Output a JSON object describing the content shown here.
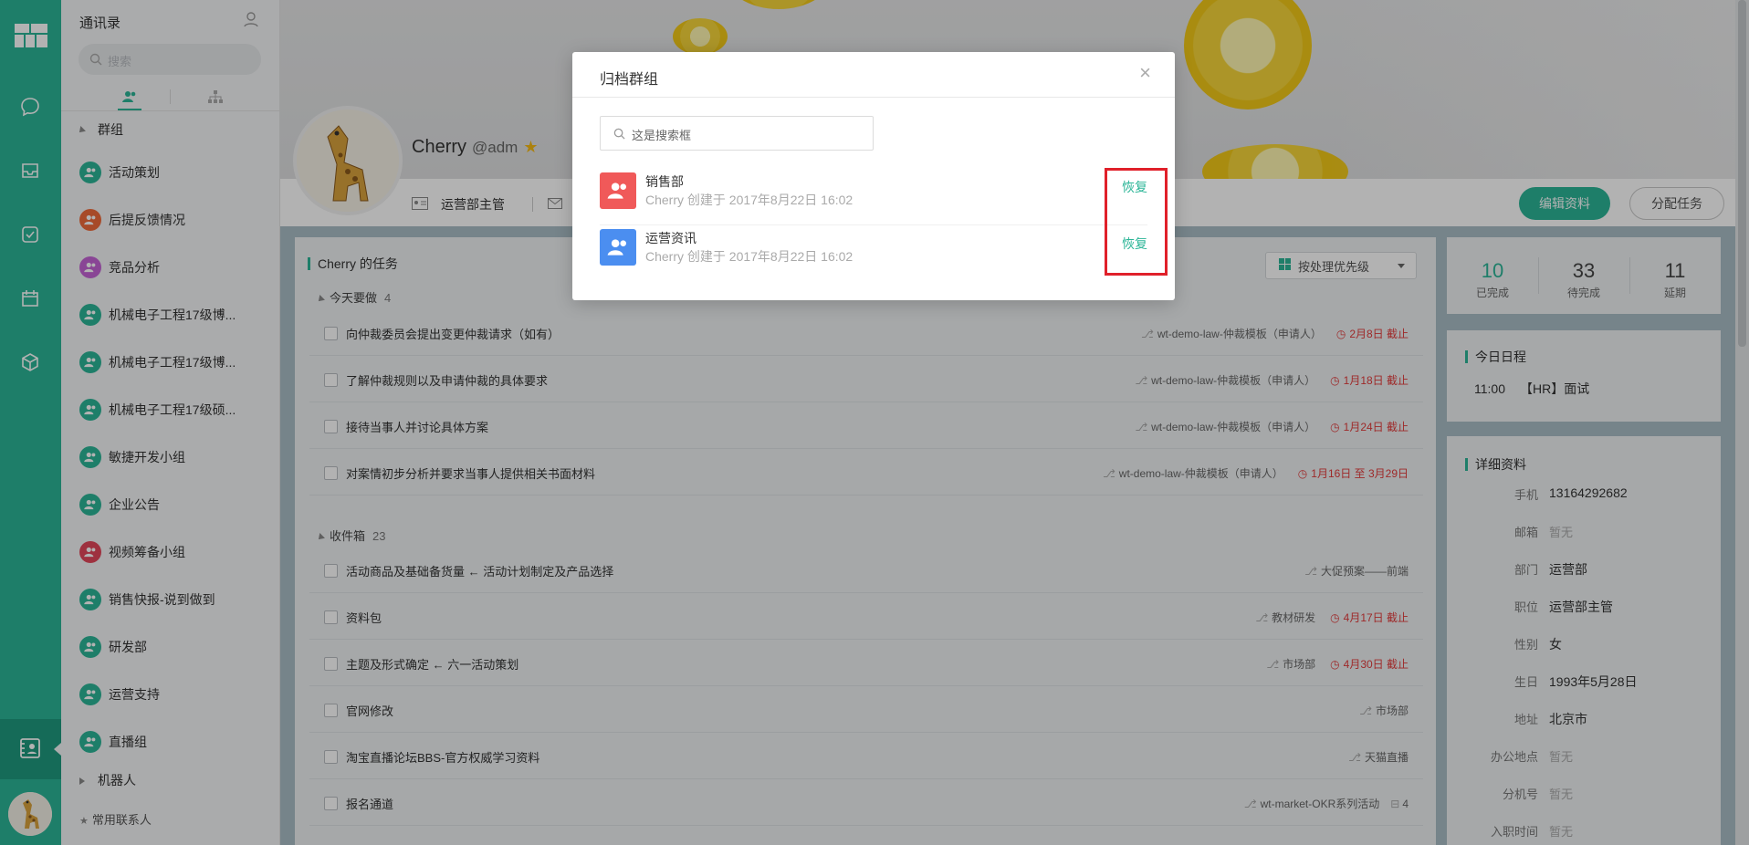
{
  "sidebar": {
    "title": "通讯录",
    "search_placeholder": "搜索",
    "groups_header": "群组",
    "groups": [
      {
        "name": "活动策划",
        "color": "#2bb597"
      },
      {
        "name": "后提反馈情况",
        "color": "#f06a3a"
      },
      {
        "name": "竞品分析",
        "color": "#c464d6"
      },
      {
        "name": "机械电子工程17级博...",
        "color": "#2bb597"
      },
      {
        "name": "机械电子工程17级博...",
        "color": "#2bb597"
      },
      {
        "name": "机械电子工程17级硕...",
        "color": "#2bb597"
      },
      {
        "name": "敏捷开发小组",
        "color": "#2bb597"
      },
      {
        "name": "企业公告",
        "color": "#2bb597"
      },
      {
        "name": "视频筹备小组",
        "color": "#e2475b"
      },
      {
        "name": "销售快报-说到做到",
        "color": "#2bb597"
      },
      {
        "name": "研发部",
        "color": "#2bb597"
      },
      {
        "name": "运营支持",
        "color": "#2bb597"
      },
      {
        "name": "直播组",
        "color": "#2bb597"
      }
    ],
    "robot_label": "机器人",
    "frequent_label": "常用联系人"
  },
  "profile": {
    "name": "Cherry",
    "handle": "@adm",
    "role": "运营部主管",
    "edit_button": "编辑资料",
    "assign_button": "分配任务"
  },
  "tasks": {
    "title": "Cherry 的任务",
    "priority_button": "按处理优先级",
    "today_label": "今天要做",
    "today_count": "4",
    "today_items": [
      {
        "name": "向仲裁委员会提出变更仲裁请求（如有）",
        "project": "wt-demo-law-仲裁模板（申请人）",
        "due": "2月8日 截止"
      },
      {
        "name": "了解仲裁规则以及申请仲裁的具体要求",
        "project": "wt-demo-law-仲裁模板（申请人）",
        "due": "1月18日 截止"
      },
      {
        "name": "接待当事人并讨论具体方案",
        "project": "wt-demo-law-仲裁模板（申请人）",
        "due": "1月24日 截止"
      },
      {
        "name": "对案情初步分析并要求当事人提供相关书面材料",
        "project": "wt-demo-law-仲裁模板（申请人）",
        "due": "1月16日 至 3月29日"
      }
    ],
    "inbox_label": "收件箱",
    "inbox_count": "23",
    "inbox_items": [
      {
        "name": "活动商品及基础备货量 ← 活动计划制定及产品选择",
        "project": "大促预案——前端",
        "due": ""
      },
      {
        "name": "资料包",
        "project": "教材研发",
        "due": "4月17日 截止"
      },
      {
        "name": "主题及形式确定 ← 六一活动策划",
        "project": "市场部",
        "due": "4月30日 截止"
      },
      {
        "name": "官网修改",
        "project": "市场部",
        "due": ""
      },
      {
        "name": "淘宝直播论坛BBS-官方权威学习资料",
        "project": "天猫直播",
        "due": ""
      },
      {
        "name": "报名通道",
        "project": "wt-market-OKR系列活动",
        "due": "",
        "sub": "4"
      }
    ]
  },
  "stats": {
    "done_num": "10",
    "done_label": "已完成",
    "todo_num": "33",
    "todo_label": "待完成",
    "delay_num": "11",
    "delay_label": "延期"
  },
  "today_schedule": {
    "title": "今日日程",
    "time": "11:00",
    "event": "【HR】面试"
  },
  "details": {
    "title": "详细资料",
    "rows": [
      {
        "k": "手机",
        "v": "13164292682",
        "muted": false
      },
      {
        "k": "邮箱",
        "v": "暂无",
        "muted": true
      },
      {
        "k": "部门",
        "v": "运营部",
        "muted": false
      },
      {
        "k": "职位",
        "v": "运营部主管",
        "muted": false
      },
      {
        "k": "性别",
        "v": "女",
        "muted": false
      },
      {
        "k": "生日",
        "v": "1993年5月28日",
        "muted": false
      },
      {
        "k": "地址",
        "v": "北京市",
        "muted": false
      },
      {
        "k": "办公地点",
        "v": "暂无",
        "muted": true
      },
      {
        "k": "分机号",
        "v": "暂无",
        "muted": true
      },
      {
        "k": "入职时间",
        "v": "暂无",
        "muted": true
      }
    ]
  },
  "modal": {
    "title": "归档群组",
    "search_placeholder": "这是搜索框",
    "items": [
      {
        "name": "销售部",
        "info": "Cherry 创建于 2017年8月22日 16:02",
        "action": "恢复",
        "color": "#f05959"
      },
      {
        "name": "运营资讯",
        "info": "Cherry 创建于 2017年8月22日 16:02",
        "action": "恢复",
        "color": "#4b8ef0"
      }
    ]
  },
  "colors": {
    "accent": "#2bb597",
    "due": "#e23c3c",
    "highlight": "#e0202a"
  }
}
